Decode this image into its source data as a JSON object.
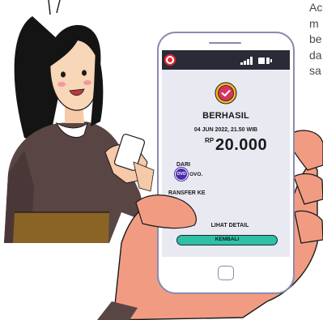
{
  "side_text": {
    "lines": [
      "Ac",
      "m",
      "be",
      "da",
      "sa"
    ]
  },
  "phone": {
    "status": {
      "app_icon": "record-dot-icon",
      "signal_icon": "signal-icon",
      "battery_icon": "battery-icon"
    },
    "success_icon": "check-badge-icon",
    "title": "BERHASIL",
    "date": "04 JUN 2022, 21.50 WIB",
    "currency": "RP",
    "amount": "20.000",
    "from_label": "DARI",
    "wallet_logo_text": "OVO",
    "wallet_name": "OVO.",
    "transfer_label": "RANSFER KE",
    "detail_link": "LIHAT DETAIL",
    "back_button": "KEMBALI",
    "home_button_icon": "home-button-icon"
  },
  "colors": {
    "accent_teal": "#2fc0a8",
    "badge_red": "#d8345f",
    "badge_yellow": "#f3b62b",
    "screen_background": "#e9e9f2",
    "phone_frame": "#8a8ab0"
  }
}
